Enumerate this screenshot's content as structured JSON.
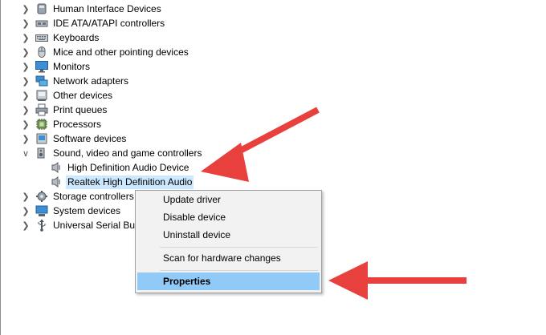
{
  "tree": {
    "items": [
      {
        "label": "Human Interface Devices",
        "icon": "hid-icon",
        "expander": "collapsed"
      },
      {
        "label": "IDE ATA/ATAPI controllers",
        "icon": "ide-controller-icon",
        "expander": "collapsed"
      },
      {
        "label": "Keyboards",
        "icon": "keyboard-icon",
        "expander": "collapsed"
      },
      {
        "label": "Mice and other pointing devices",
        "icon": "mouse-icon",
        "expander": "collapsed"
      },
      {
        "label": "Monitors",
        "icon": "monitor-icon",
        "expander": "collapsed"
      },
      {
        "label": "Network adapters",
        "icon": "network-adapter-icon",
        "expander": "collapsed"
      },
      {
        "label": "Other devices",
        "icon": "other-devices-icon",
        "expander": "collapsed"
      },
      {
        "label": "Print queues",
        "icon": "printer-icon",
        "expander": "collapsed"
      },
      {
        "label": "Processors",
        "icon": "processor-icon",
        "expander": "collapsed"
      },
      {
        "label": "Software devices",
        "icon": "software-device-icon",
        "expander": "collapsed"
      },
      {
        "label": "Sound, video and game controllers",
        "icon": "speaker-icon",
        "expander": "expanded"
      },
      {
        "label": "High Definition Audio Device",
        "icon": "speaker-icon",
        "expander": "none"
      },
      {
        "label": "Realtek High Definition Audio",
        "icon": "speaker-icon",
        "expander": "none",
        "selected": true
      },
      {
        "label": "Storage controllers",
        "icon": "storage-controller-icon",
        "expander": "collapsed"
      },
      {
        "label": "System devices",
        "icon": "system-device-icon",
        "expander": "collapsed"
      },
      {
        "label": "Universal Serial Bus",
        "icon": "usb-icon",
        "expander": "collapsed"
      }
    ]
  },
  "context_menu": {
    "items": [
      {
        "label": "Update driver"
      },
      {
        "label": "Disable device"
      },
      {
        "label": "Uninstall device"
      },
      {
        "label": "Scan for hardware changes"
      },
      {
        "label": "Properties",
        "highlighted": true
      }
    ]
  },
  "colors": {
    "selection": "#cce8ff",
    "menu_highlight": "#91c9f7",
    "annotation_arrow": "#e8403d"
  }
}
